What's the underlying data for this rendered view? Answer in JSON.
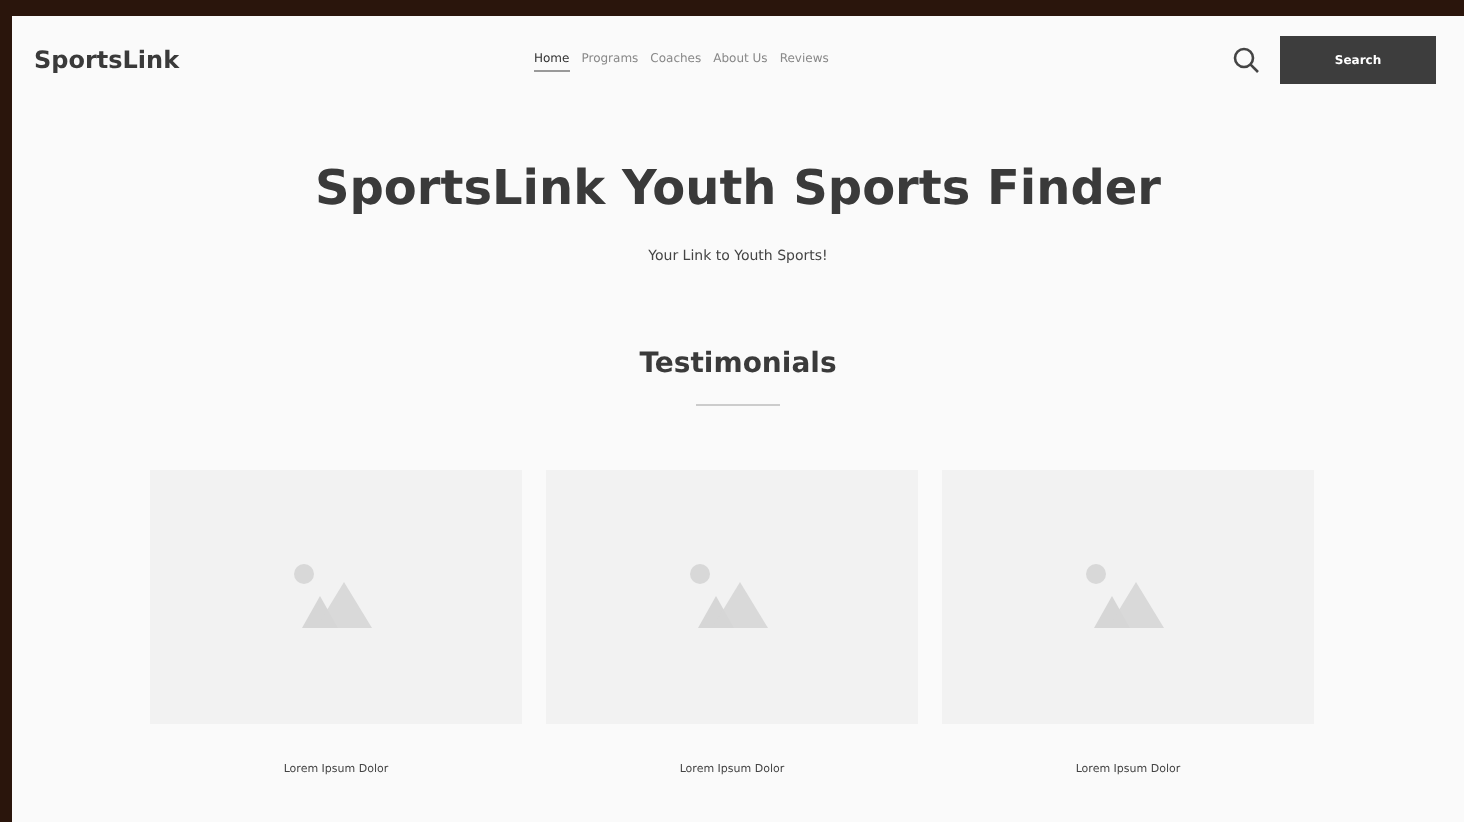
{
  "header": {
    "logo": "SportsLink",
    "nav": [
      {
        "label": "Home",
        "selected": true
      },
      {
        "label": "Programs",
        "selected": false
      },
      {
        "label": "Coaches",
        "selected": false
      },
      {
        "label": "About Us",
        "selected": false
      },
      {
        "label": "Reviews",
        "selected": false
      }
    ],
    "search_button": "Search"
  },
  "hero": {
    "title": "SportsLink Youth Sports Finder",
    "subtitle": "Your Link to Youth Sports!"
  },
  "testimonials": {
    "heading": "Testimonials",
    "cards": [
      {
        "caption": "Lorem Ipsum Dolor"
      },
      {
        "caption": "Lorem Ipsum Dolor"
      },
      {
        "caption": "Lorem Ipsum Dolor"
      }
    ]
  }
}
